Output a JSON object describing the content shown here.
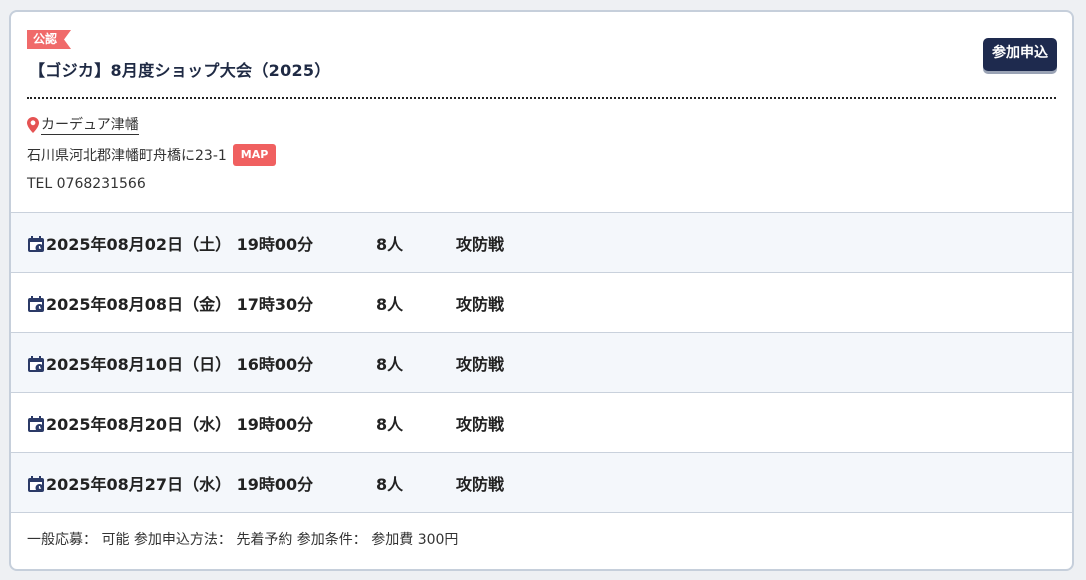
{
  "event": {
    "badge": "公認",
    "title": "【ゴジカ】8月度ショップ大会（2025）",
    "apply_label": "参加申込"
  },
  "shop": {
    "name": "カーデュア津幡",
    "address": "石川県河北郡津幡町舟橋に23-1",
    "map_label": "MAP",
    "tel": "TEL 0768231566"
  },
  "schedule": [
    {
      "date": "2025年08月02日（土） 19時00分",
      "people": "8人",
      "type": "攻防戦"
    },
    {
      "date": "2025年08月08日（金） 17時30分",
      "people": "8人",
      "type": "攻防戦"
    },
    {
      "date": "2025年08月10日（日） 16時00分",
      "people": "8人",
      "type": "攻防戦"
    },
    {
      "date": "2025年08月20日（水） 19時00分",
      "people": "8人",
      "type": "攻防戦"
    },
    {
      "date": "2025年08月27日（水） 19時00分",
      "people": "8人",
      "type": "攻防戦"
    }
  ],
  "footer": {
    "text": "一般応募： 可能 参加申込方法： 先着予約 参加条件： 参加費 300円"
  },
  "colors": {
    "accent_red": "#f06a6a",
    "navy": "#1e2a4e",
    "row_alt": "#f4f7fb"
  },
  "icons": {
    "pin": "map-pin-icon",
    "calendar": "calendar-icon"
  }
}
